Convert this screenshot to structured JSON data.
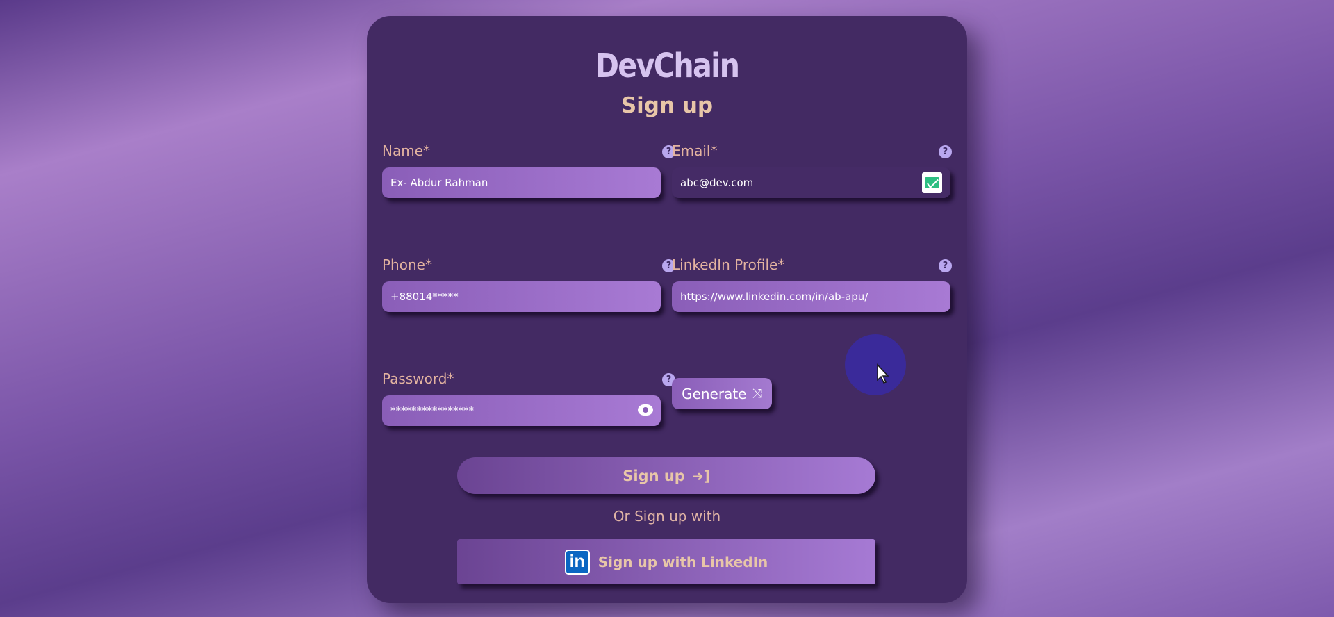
{
  "brand": "DevChain",
  "form": {
    "title": "Sign up",
    "help_glyph": "?",
    "name": {
      "label": "Name*",
      "value": "Ex- Abdur Rahman"
    },
    "email": {
      "label": "Email*",
      "value": "abc@dev.com",
      "icon": "mail-icon"
    },
    "phone": {
      "label": "Phone*",
      "value": "+88014*****"
    },
    "linkedin": {
      "label": "LinkedIn Profile*",
      "value": "https://www.linkedin.com/in/ab-apu/"
    },
    "password": {
      "label": "Password*",
      "value": "****************",
      "icon": "eye-icon"
    },
    "generate_label": "Generate",
    "submit_label": "Sign up",
    "alt_text": "Or Sign up with",
    "linkedin_button_label": "Sign up with LinkedIn",
    "linkedin_logo_text": "in"
  },
  "colors": {
    "card": "#432a63",
    "accent": "#a87ad4",
    "label": "#e3b3a0",
    "brand": "#d6c3ef",
    "linkedin": "#0a66c2"
  }
}
